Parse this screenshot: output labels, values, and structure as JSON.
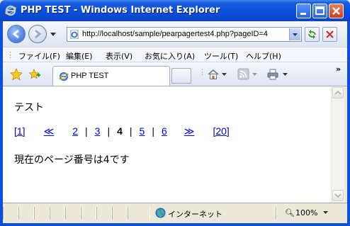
{
  "window": {
    "title": "PHP TEST - Windows Internet Explorer"
  },
  "address": {
    "url": "http://localhost/sample/pearpagertest4.php?pageID=4"
  },
  "menu": [
    "ファイル(F)",
    "編集(E)",
    "表示(V)",
    "お気に入り(A)",
    "ツール(T)",
    "ヘルプ(H)"
  ],
  "tab": {
    "label": "PHP TEST"
  },
  "content": {
    "heading": "テスト",
    "pager": {
      "first": "[1]",
      "prev": "≪",
      "p2": "2",
      "p3": "3",
      "current": "4",
      "p5": "5",
      "p6": "6",
      "next": "≫",
      "last": "[20]",
      "sep": "|"
    },
    "message": "現在のページ番号は4です"
  },
  "status": {
    "zone": "インターネット",
    "zoom": "100%"
  }
}
